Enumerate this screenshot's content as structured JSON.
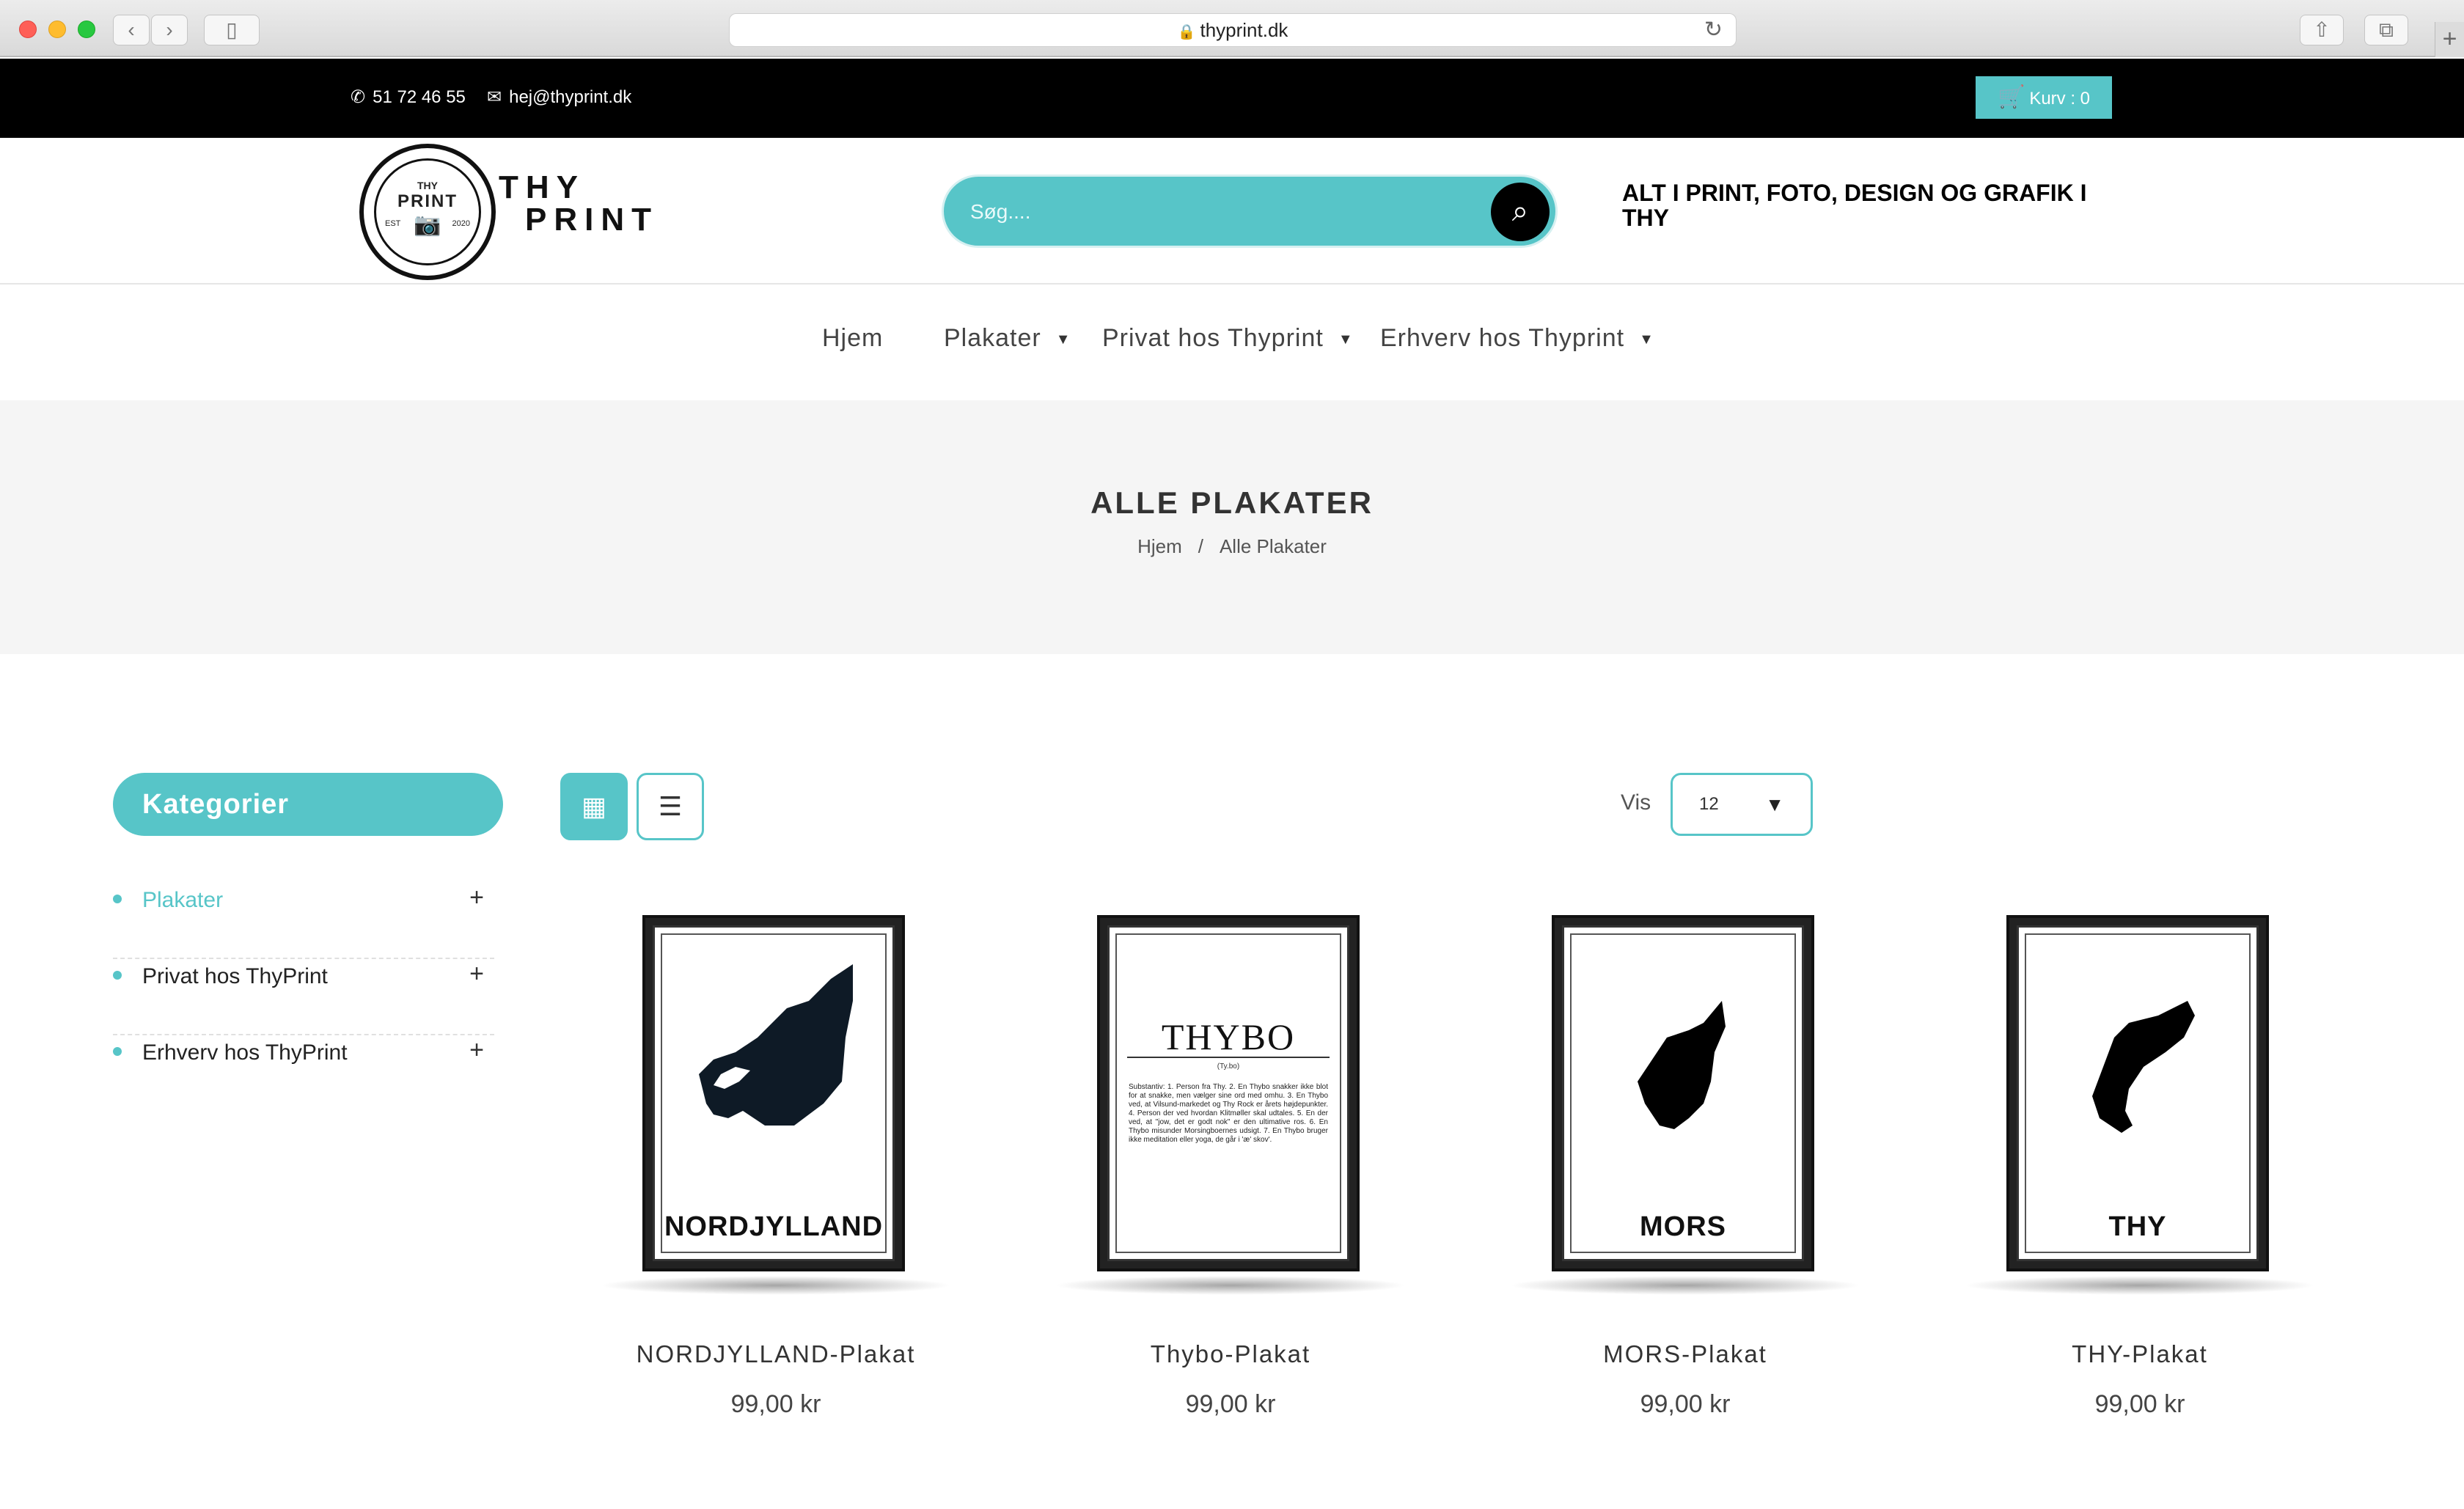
{
  "browser": {
    "url": "thyprint.dk"
  },
  "topbar": {
    "phone": "51 72 46 55",
    "email": "hej@thyprint.dk",
    "cart_label": "Kurv : 0"
  },
  "header": {
    "logo_small_top": "THY",
    "logo_mid": "PRINT",
    "logo_est": "EST",
    "logo_year": "2020",
    "logo_line1": "THY",
    "logo_line2": "PRINT",
    "search_placeholder": "Søg....",
    "tagline": "ALT I PRINT, FOTO, DESIGN OG GRAFIK I THY"
  },
  "nav": {
    "items": [
      {
        "label": "Hjem"
      },
      {
        "label": "Plakater"
      },
      {
        "label": "Privat hos Thyprint"
      },
      {
        "label": "Erhverv hos Thyprint"
      }
    ]
  },
  "page": {
    "title": "ALLE PLAKATER",
    "breadcrumb": [
      "Hjem",
      "/",
      "Alle Plakater"
    ]
  },
  "sidebar": {
    "heading": "Kategorier",
    "items": [
      {
        "label": "Plakater",
        "active": true
      },
      {
        "label": "Privat hos ThyPrint",
        "active": false
      },
      {
        "label": "Erhverv hos ThyPrint",
        "active": false
      }
    ]
  },
  "toolbar": {
    "vis_label": "Vis",
    "vis_value": "12"
  },
  "products": [
    {
      "poster_text": "NORDJYLLAND",
      "title": "NORDJYLLAND-Plakat",
      "price": "99,00 kr"
    },
    {
      "poster_text": "THYBO",
      "poster_sub": "(Ty.bo)",
      "poster_body": "Substantiv: 1. Person fra Thy. 2. En Thybo snakker ikke blot for at snakke, men vælger sine ord med omhu. 3. En Thybo ved, at Vilsund-markedet og Thy Rock er årets højdepunkter. 4. Person der ved hvordan Klitmøller skal udtales. 5. En der ved, at \"jow, det er godt nok\" er den ultimative ros. 6. En Thybo misunder Morsingboernes udsigt. 7. En Thybo bruger ikke meditation eller yoga, de går i 'æ' skov'.",
      "title": "Thybo-Plakat",
      "price": "99,00 kr"
    },
    {
      "poster_text": "MORS",
      "title": "MORS-Plakat",
      "price": "99,00 kr"
    },
    {
      "poster_text": "THY",
      "title": "THY-Plakat",
      "price": "99,00 kr"
    }
  ]
}
